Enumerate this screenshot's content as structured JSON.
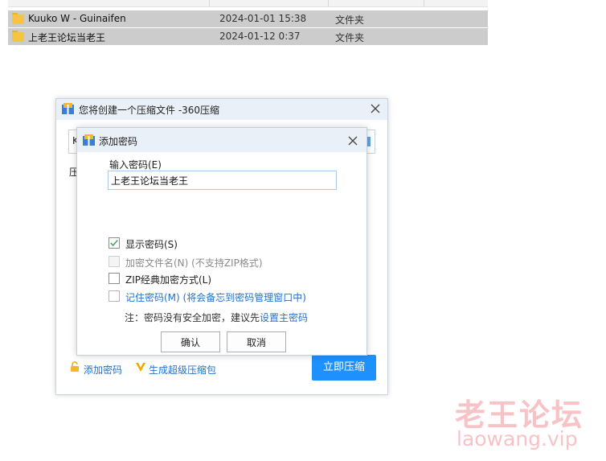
{
  "explorer": {
    "files": [
      {
        "name": "Kuuko W - Guinaifen",
        "date": "2024-01-01 15:38",
        "type": "文件夹"
      },
      {
        "name": "上老王论坛当老王",
        "date": "2024-01-12 0:37",
        "type": "文件夹"
      }
    ]
  },
  "compress_dialog": {
    "title": "您将创建一个压缩文件 -360压缩",
    "path_partial": "K",
    "label_partial": "压",
    "add_password_link": "添加密码",
    "super_package_link": "生成超级压缩包",
    "compress_button": "立即压缩"
  },
  "password_dialog": {
    "title": "添加密码",
    "password_label": "输入密码(E)",
    "password_value": "上老王论坛当老王",
    "options": {
      "show_password": {
        "label": "显示密码(S)",
        "checked": true
      },
      "encrypt_filenames": {
        "label": "加密文件名(N) (不支持ZIP格式)",
        "checked": false,
        "enabled": false
      },
      "zip_classic": {
        "label": "ZIP经典加密方式(L)",
        "checked": false
      },
      "remember_password": {
        "label": "记住密码(M) (将会备忘到密码管理窗口中)",
        "checked": false
      }
    },
    "note_prefix": "注：密码没有安全加密，建议先",
    "note_link": "设置主密码",
    "ok_button": "确认",
    "cancel_button": "取消"
  },
  "watermark": {
    "text": "老王论坛",
    "url": "laowang.vip"
  },
  "colors": {
    "accent": "#1e90ff",
    "link": "#2472c8",
    "title_bar": "#e9f0f8",
    "check": "#2f9e44",
    "watermark": "#f7c3c6"
  }
}
